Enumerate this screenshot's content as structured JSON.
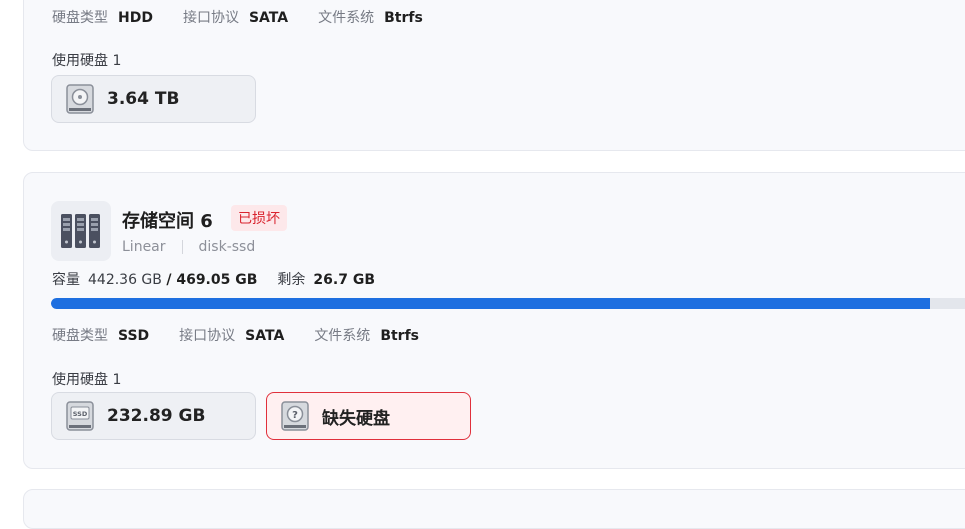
{
  "pool1": {
    "meta": {
      "disk_type_label": "硬盘类型",
      "disk_type_value": "HDD",
      "interface_label": "接口协议",
      "interface_value": "SATA",
      "fs_label": "文件系统",
      "fs_value": "Btrfs"
    },
    "disks_used_label": "使用硬盘 1",
    "disks": [
      {
        "size": "3.64 TB",
        "icon": "hdd-icon"
      }
    ]
  },
  "pool2": {
    "title": "存储空间 6",
    "status": "已损坏",
    "raid": "Linear",
    "name": "disk-ssd",
    "icon": "server-rack-icon",
    "capacity": {
      "label": "容量",
      "used": "442.36 GB",
      "total": "/ 469.05 GB",
      "remain_label": "剩余",
      "remain_value": "26.7 GB",
      "used_fraction": 0.943
    },
    "meta": {
      "disk_type_label": "硬盘类型",
      "disk_type_value": "SSD",
      "interface_label": "接口协议",
      "interface_value": "SATA",
      "fs_label": "文件系统",
      "fs_value": "Btrfs"
    },
    "disks_used_label": "使用硬盘 1",
    "disks": [
      {
        "size": "232.89 GB",
        "icon": "ssd-icon"
      },
      {
        "size": "缺失硬盘",
        "icon": "missing-disk-icon",
        "status": "missing"
      }
    ]
  },
  "colors": {
    "accent": "#1e6fe0",
    "danger": "#d9232e",
    "danger_bg": "#fde8ea"
  }
}
